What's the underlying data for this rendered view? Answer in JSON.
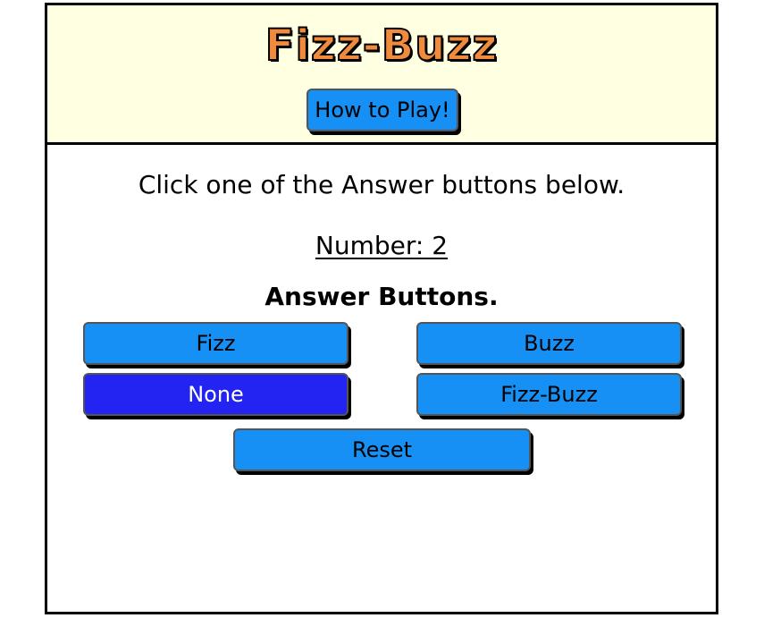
{
  "header": {
    "title": "Fizz-Buzz",
    "how_to_play_label": "How to Play!"
  },
  "main": {
    "instructions": "Click one of the Answer buttons below.",
    "number_label": "Number: 2",
    "answers_heading": "Answer Buttons.",
    "buttons": {
      "fizz": "Fizz",
      "buzz": "Buzz",
      "none": "None",
      "fizz_buzz": "Fizz-Buzz",
      "reset": "Reset"
    },
    "selected_answer": "None"
  },
  "colors": {
    "header_bg": "#ffffe1",
    "title_orange": "#f08a3c",
    "button_blue": "#1790f5",
    "selected_blue": "#2323f2"
  }
}
